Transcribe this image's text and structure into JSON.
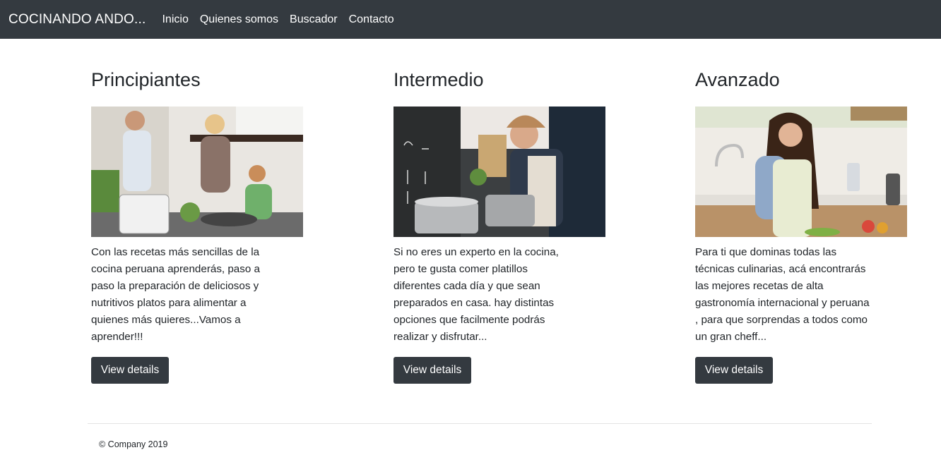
{
  "navbar": {
    "brand": "COCINANDO ANDO...",
    "links": [
      "Inicio",
      "Quienes somos",
      "Buscador",
      "Contacto"
    ]
  },
  "columns": [
    {
      "title": "Principiantes",
      "text": "Con las recetas más sencillas de la cocina peruana aprenderás, paso a paso la preparación de deliciosos y nutritivos platos para alimentar a quienes más quieres...Vamos a aprender!!!",
      "button": "View details"
    },
    {
      "title": "Intermedio",
      "text": "Si no eres un experto en la cocina, pero te gusta comer platillos diferentes cada día y que sean preparados en casa. hay distintas opciones que facilmente podrás realizar y disfrutar...",
      "button": "View details"
    },
    {
      "title": "Avanzado",
      "text": "Para ti que dominas todas las técnicas culinarias, acá encontrarás las mejores recetas de alta gastronomía internacional y peruana , para que sorprendas a todos como un gran cheff...",
      "button": "View details"
    }
  ],
  "footer": {
    "text": "© Company 2019"
  },
  "colors": {
    "navbar_bg": "#343a40",
    "button_bg": "#343a40",
    "text": "#212529"
  }
}
